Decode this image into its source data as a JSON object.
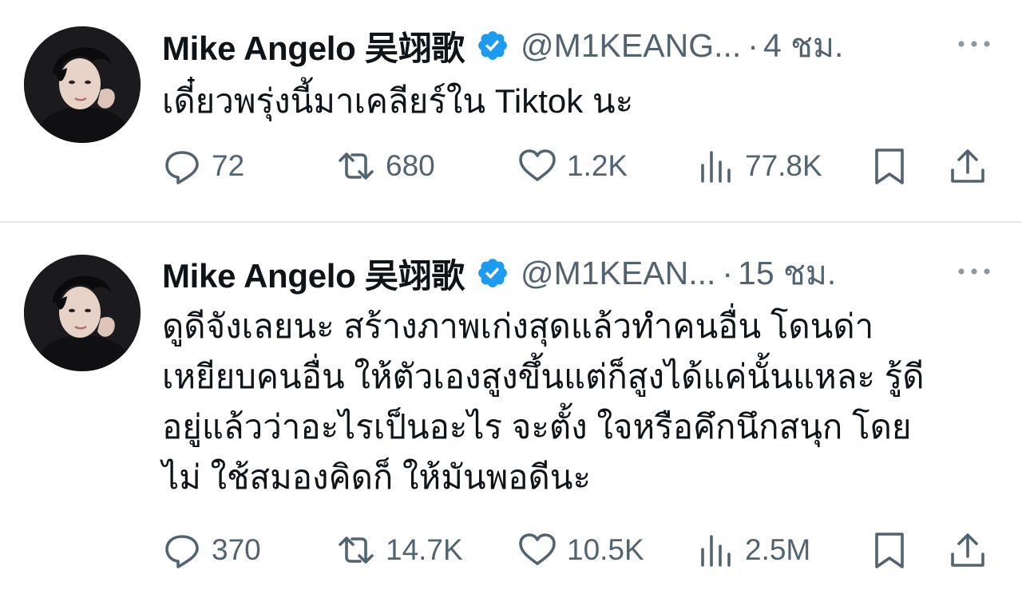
{
  "tweets": [
    {
      "author": "Mike Angelo 吴翊歌",
      "handle": "@M1KEANG...",
      "separator": "·",
      "time": "4 ชม.",
      "text": "เดี๋ยวพรุ่งนี้มาเคลียร์ใน Tiktok นะ",
      "replies": "72",
      "retweets": "680",
      "likes": "1.2K",
      "views": "77.8K"
    },
    {
      "author": "Mike Angelo 吴翊歌",
      "handle": "@M1KEAN...",
      "separator": "·",
      "time": "15 ชม.",
      "text": "ดูดีจังเลยนะ สร้างภาพเก่งสุดแล้วทำคนอื่น โดนด่า\nเหยียบคนอื่น ให้ตัวเองสูงขึ้นแต่ก็สูงได้แค่นั้นแหละ รู้ดี\nอยู่แล้วว่าอะไรเป็นอะไร จะตั้ง ใจหรือคึกนึกสนุก โดย\nไม่ ใช้สมองคิดก็ ให้มันพอดีนะ",
      "replies": "370",
      "retweets": "14.7K",
      "likes": "10.5K",
      "views": "2.5M"
    }
  ],
  "icons": {
    "verified": "verified-badge-icon",
    "more": "more-horizontal-icon",
    "reply": "reply-icon",
    "retweet": "retweet-icon",
    "like": "heart-icon",
    "views": "views-bar-chart-icon",
    "bookmark": "bookmark-icon",
    "share": "share-icon"
  },
  "colors": {
    "text": "#0f1419",
    "secondary": "#536471",
    "verified": "#1d9bf0",
    "divider": "#e4e8eb"
  }
}
